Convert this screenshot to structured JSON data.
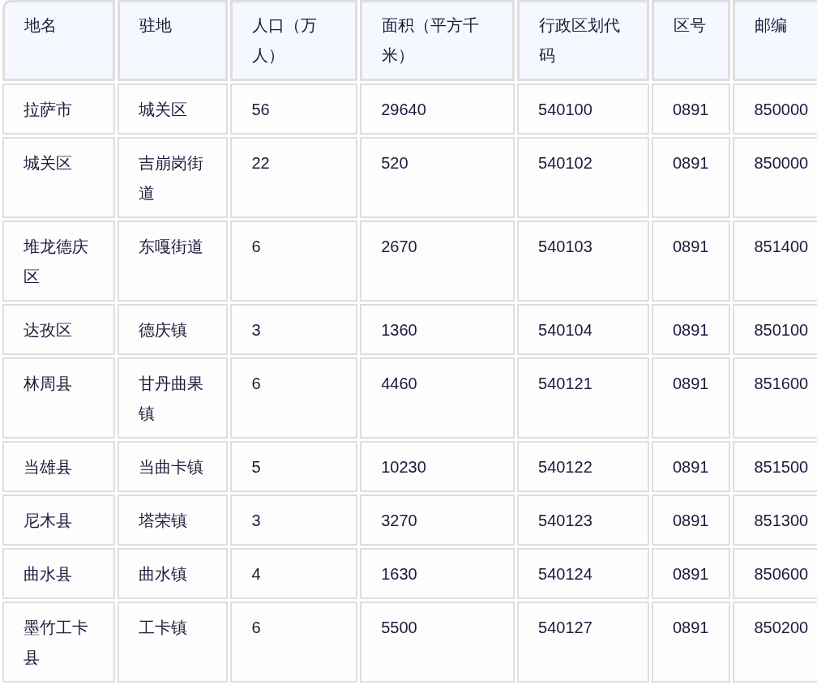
{
  "table": {
    "columns": [
      "地名",
      "驻地",
      "人口（万人）",
      "面积（平方千米）",
      "行政区划代码",
      "区号",
      "邮编"
    ],
    "rows": [
      [
        "拉萨市",
        "城关区",
        "56",
        "29640",
        "540100",
        "0891",
        "850000"
      ],
      [
        "城关区",
        "吉崩岗街道",
        "22",
        "520",
        "540102",
        "0891",
        "850000"
      ],
      [
        "堆龙德庆区",
        "东嘎街道",
        "6",
        "2670",
        "540103",
        "0891",
        "851400"
      ],
      [
        "达孜区",
        "德庆镇",
        "3",
        "1360",
        "540104",
        "0891",
        "850100"
      ],
      [
        "林周县",
        "甘丹曲果镇",
        "6",
        "4460",
        "540121",
        "0891",
        "851600"
      ],
      [
        "当雄县",
        "当曲卡镇",
        "5",
        "10230",
        "540122",
        "0891",
        "851500"
      ],
      [
        "尼木县",
        "塔荣镇",
        "3",
        "3270",
        "540123",
        "0891",
        "851300"
      ],
      [
        "曲水县",
        "曲水镇",
        "4",
        "1630",
        "540124",
        "0891",
        "850600"
      ],
      [
        "墨竹工卡县",
        "工卡镇",
        "6",
        "5500",
        "540127",
        "0891",
        "850200"
      ]
    ]
  }
}
